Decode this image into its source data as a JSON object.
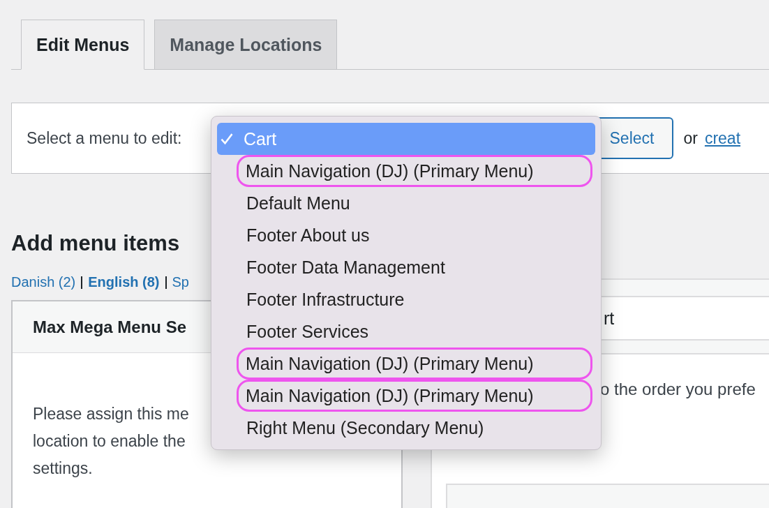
{
  "tabs": [
    {
      "label": "Edit Menus",
      "selected": true
    },
    {
      "label": "Manage Locations",
      "selected": false
    }
  ],
  "menu_select": {
    "label": "Select a menu to edit:",
    "button": "Select",
    "or_text": "or",
    "create_link": "creat"
  },
  "add_items": {
    "heading": "Add menu items",
    "languages": [
      {
        "label": "Danish (2)",
        "selected": false
      },
      {
        "label": "English (8)",
        "selected": true
      },
      {
        "label": "Sp",
        "selected": false
      }
    ],
    "card_title": "Max Mega Menu Se",
    "card_lines": [
      "Please assign this me",
      "location to enable the",
      "settings."
    ]
  },
  "menu_structure": {
    "name_value": "rt",
    "hint": "o the order you prefe"
  },
  "dropdown": [
    {
      "label": "Cart",
      "selected": true,
      "highlighted": false
    },
    {
      "label": "Main Navigation (DJ) (Primary Menu)",
      "selected": false,
      "highlighted": true
    },
    {
      "label": "Default Menu",
      "selected": false,
      "highlighted": false
    },
    {
      "label": "Footer About us",
      "selected": false,
      "highlighted": false
    },
    {
      "label": "Footer Data Management",
      "selected": false,
      "highlighted": false
    },
    {
      "label": "Footer Infrastructure",
      "selected": false,
      "highlighted": false
    },
    {
      "label": "Footer Services",
      "selected": false,
      "highlighted": false
    },
    {
      "label": "Main Navigation (DJ) (Primary Menu)",
      "selected": false,
      "highlighted": true
    },
    {
      "label": "Main Navigation (DJ) (Primary Menu)",
      "selected": false,
      "highlighted": true
    },
    {
      "label": "Right Menu (Secondary Menu)",
      "selected": false,
      "highlighted": false
    }
  ]
}
